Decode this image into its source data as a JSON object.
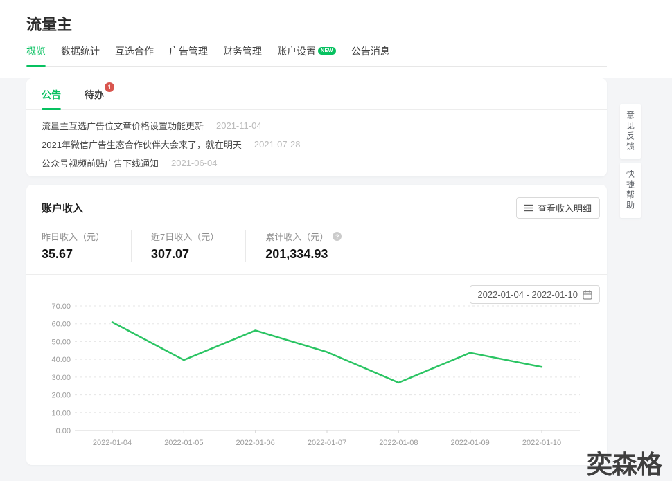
{
  "page": {
    "title": "流量主",
    "watermark": "奕森格"
  },
  "nav": {
    "tabs": [
      {
        "label": "概览",
        "active": true
      },
      {
        "label": "数据统计"
      },
      {
        "label": "互选合作"
      },
      {
        "label": "广告管理"
      },
      {
        "label": "财务管理"
      },
      {
        "label": "账户设置",
        "badge": "NEW"
      },
      {
        "label": "公告消息"
      }
    ]
  },
  "announcements": {
    "tab_announcement": "公告",
    "tab_todo": "待办",
    "todo_badge": "1",
    "items": [
      {
        "text": "流量主互选广告位文章价格设置功能更新",
        "date": "2021-11-04"
      },
      {
        "text": "2021年微信广告生态合作伙伴大会来了，就在明天",
        "date": "2021-07-28"
      },
      {
        "text": "公众号视频前贴广告下线通知",
        "date": "2021-06-04"
      }
    ]
  },
  "income": {
    "title": "账户收入",
    "detail_button": "查看收入明细",
    "stats": [
      {
        "label": "昨日收入（元）",
        "value": "35.67"
      },
      {
        "label": "近7日收入（元）",
        "value": "307.07"
      },
      {
        "label": "累计收入（元）",
        "value": "201,334.93"
      }
    ],
    "help_glyph": "?",
    "date_range": "2022-01-04 - 2022-01-10"
  },
  "sidebar": {
    "feedback": "意见反馈",
    "help": "快捷帮助"
  },
  "chart_data": {
    "type": "line",
    "title": "",
    "x": [
      "2022-01-04",
      "2022-01-05",
      "2022-01-06",
      "2022-01-07",
      "2022-01-08",
      "2022-01-09",
      "2022-01-10"
    ],
    "values": [
      60.91,
      39.62,
      56.21,
      44.1,
      26.89,
      43.67,
      35.67
    ],
    "ylim": [
      0,
      70
    ],
    "ytick_step": 10,
    "grid": "dashed-horizontal",
    "legend": "none",
    "line_color": "#2bc463",
    "grid_color": "#e5e5e5",
    "axis_color": "#d6d6d6",
    "label_color": "#9b9b9b"
  },
  "colors": {
    "accent_green": "#07c160",
    "badge_red": "#d9554e",
    "card_bg": "#ffffff",
    "page_bg": "#f4f5f7"
  }
}
